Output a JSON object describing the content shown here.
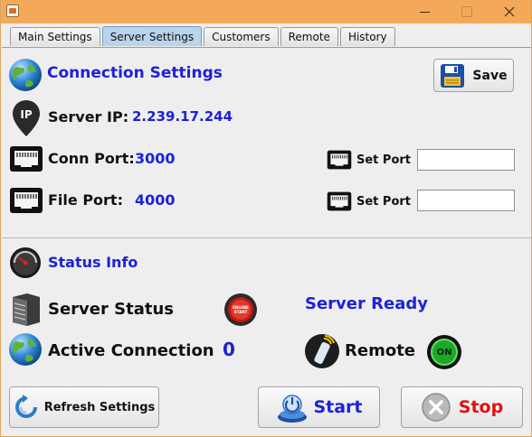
{
  "window": {
    "title": ""
  },
  "tabs": [
    {
      "label": "Main Settings"
    },
    {
      "label": "Server Settings",
      "active": true
    },
    {
      "label": "Customers"
    },
    {
      "label": "Remote"
    },
    {
      "label": "History"
    }
  ],
  "connection": {
    "heading": "Connection Settings",
    "save_label": "Save",
    "server_ip_label": "Server IP:",
    "server_ip_value": "2.239.17.244",
    "conn_port_label": "Conn Port:",
    "conn_port_value": "3000",
    "file_port_label": "File Port:",
    "file_port_value": "4000",
    "set_port_label_1": "Set Port",
    "set_port_label_2": "Set Port",
    "set_port_value_1": "",
    "set_port_value_2": ""
  },
  "status": {
    "heading": "Status Info",
    "server_status_label": "Server Status",
    "server_status_value": "Server Ready",
    "active_connection_label": "Active Connection",
    "active_connection_value": "0",
    "remote_label": "Remote",
    "remote_toggle_text": "ON",
    "engine_button_text": "ENGINE START"
  },
  "footer": {
    "refresh_label": "Refresh Settings",
    "start_label": "Start",
    "stop_label": "Stop"
  },
  "colors": {
    "accent_blue": "#1d22d6",
    "stop_red": "#e01010",
    "titlebar": "#f4a95a",
    "tab_active": "#b9d3ec"
  },
  "icons": [
    "globe-icon",
    "floppy-disk-icon",
    "ip-pin-icon",
    "ethernet-port-icon",
    "gauge-icon",
    "server-rack-icon",
    "engine-start-icon",
    "remote-control-icon",
    "on-toggle-icon",
    "refresh-icon",
    "power-icon",
    "stop-x-icon"
  ]
}
